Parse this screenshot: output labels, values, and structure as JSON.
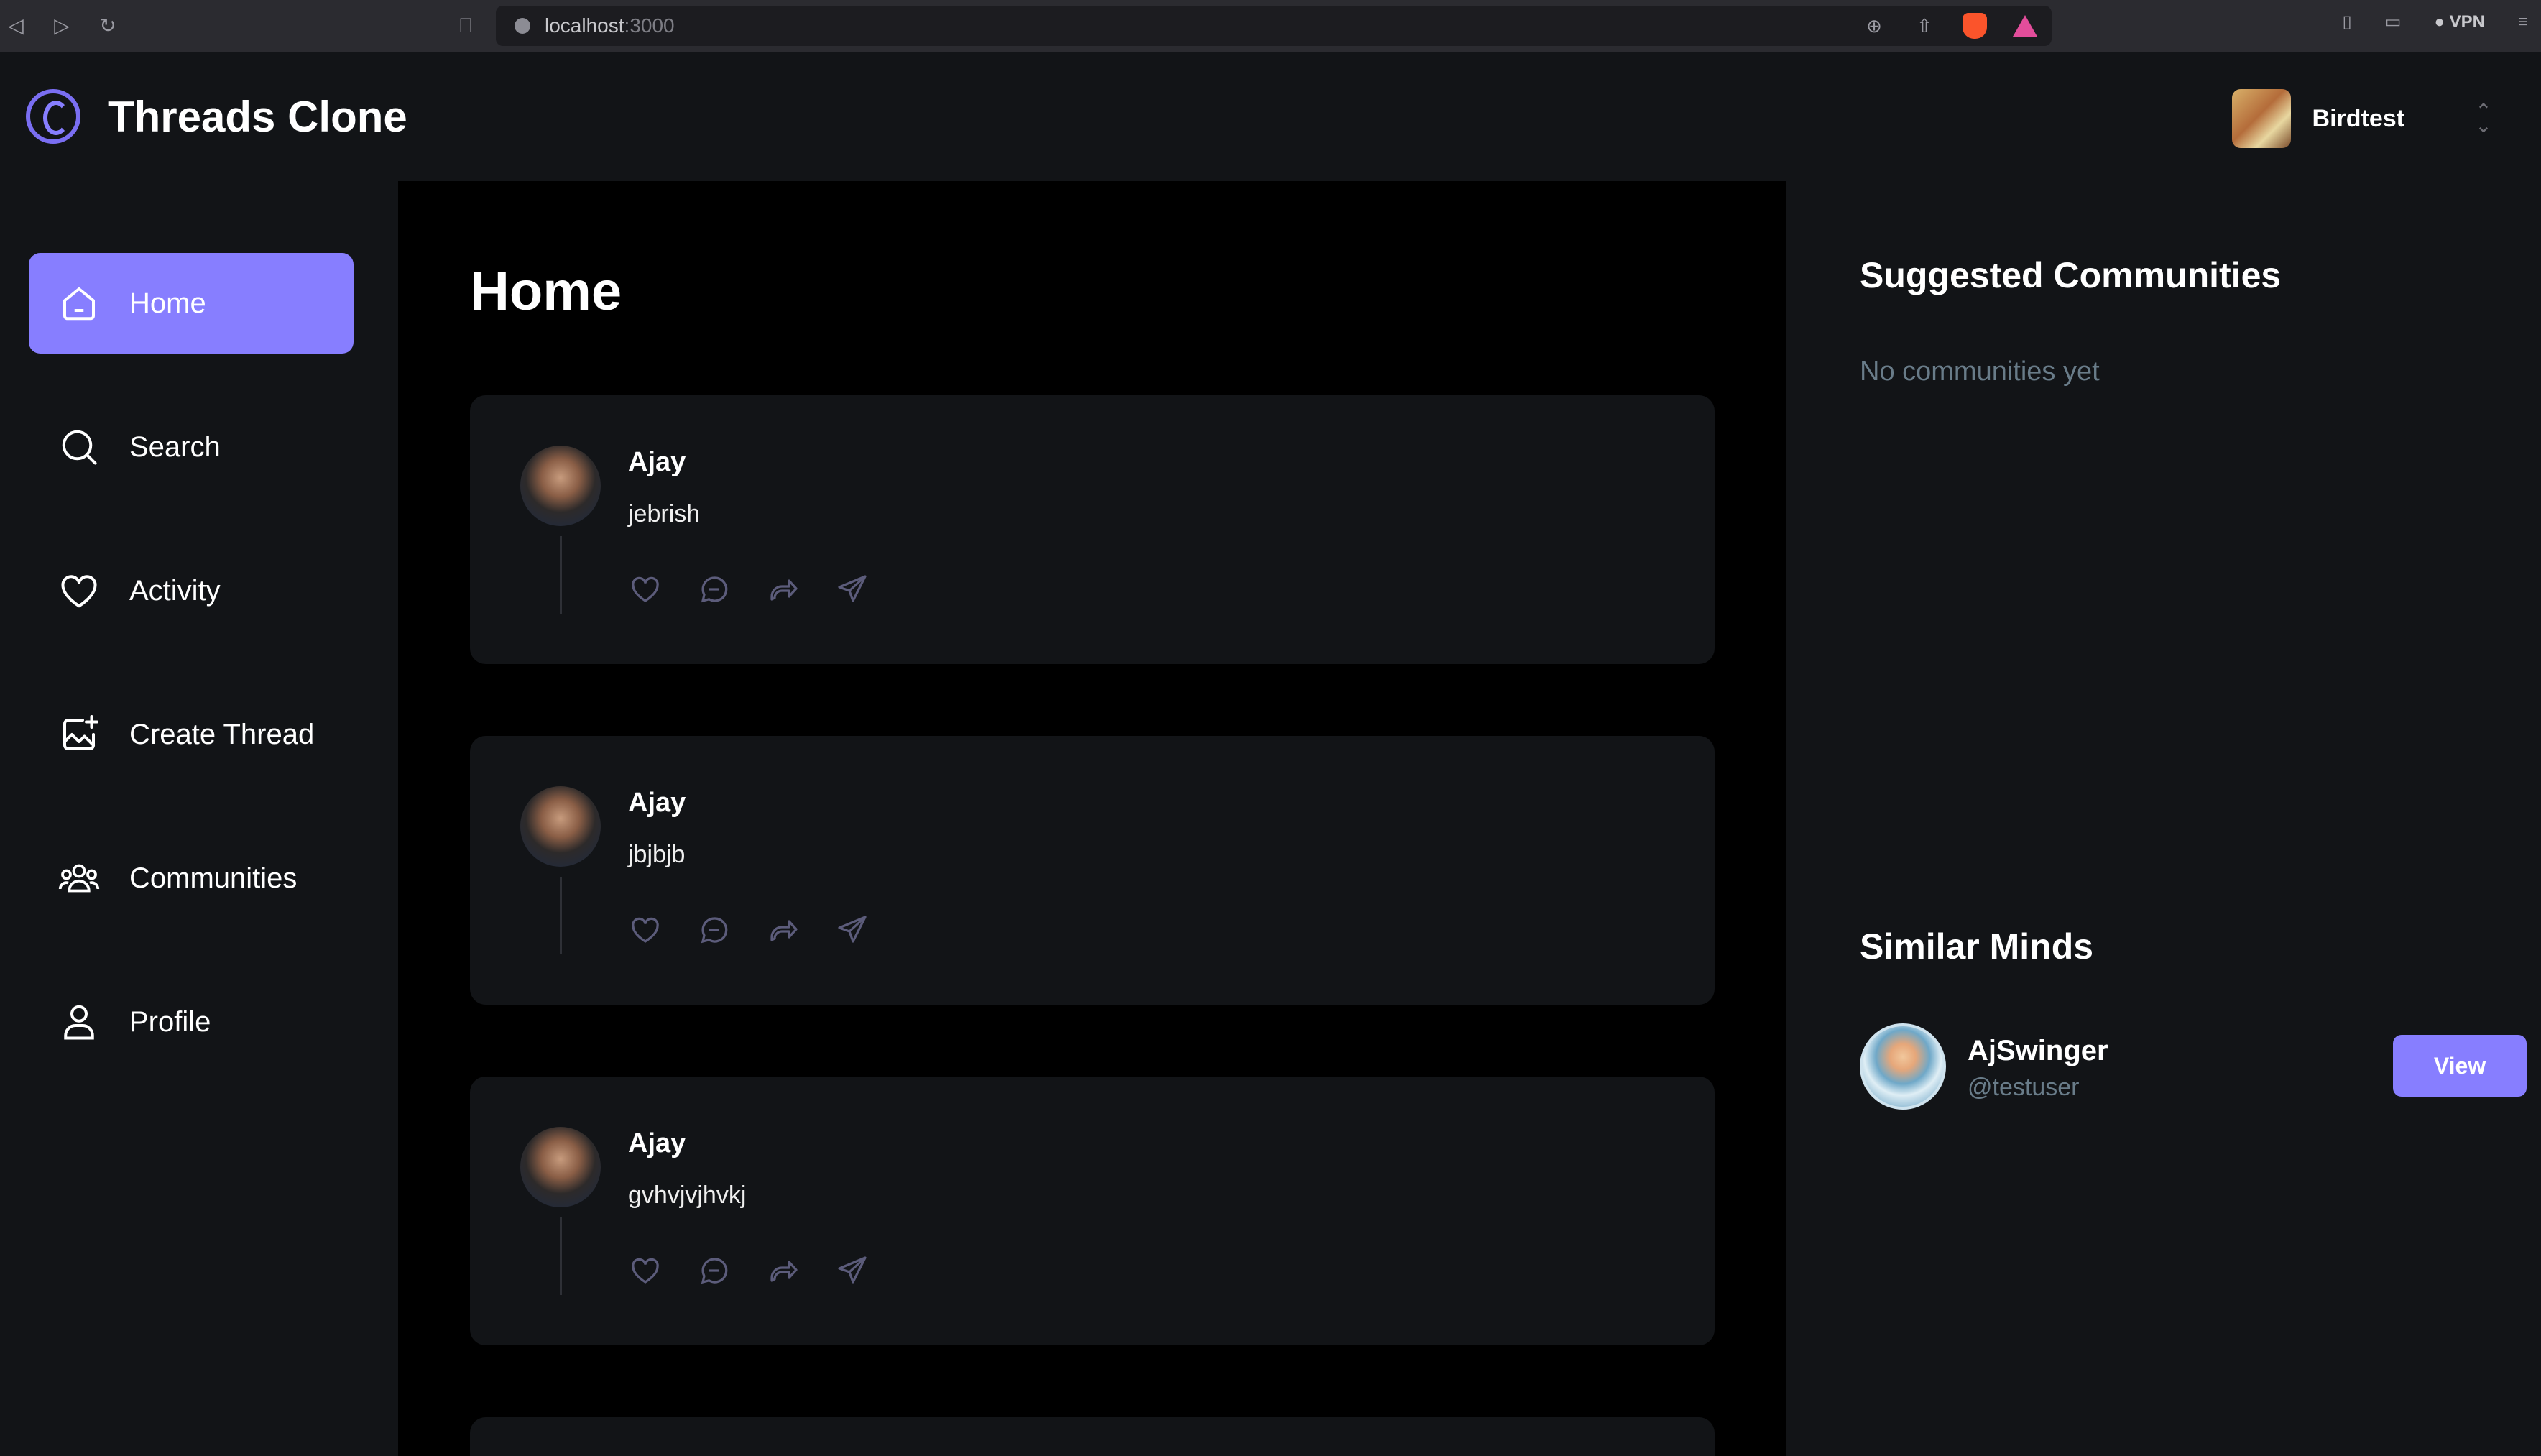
{
  "browser": {
    "url_host": "localhost",
    "url_port": ":3000",
    "vpn_label": "VPN"
  },
  "header": {
    "app_title": "Threads Clone",
    "org_name": "Birdtest"
  },
  "sidebar": {
    "items": [
      {
        "label": "Home",
        "icon": "home-icon",
        "active": true
      },
      {
        "label": "Search",
        "icon": "search-icon",
        "active": false
      },
      {
        "label": "Activity",
        "icon": "heart-icon",
        "active": false
      },
      {
        "label": "Create Thread",
        "icon": "create-thread-icon",
        "active": false
      },
      {
        "label": "Communities",
        "icon": "communities-icon",
        "active": false
      },
      {
        "label": "Profile",
        "icon": "profile-icon",
        "active": false
      }
    ]
  },
  "main": {
    "title": "Home",
    "threads": [
      {
        "author": "Ajay",
        "content": "jebrish"
      },
      {
        "author": "Ajay",
        "content": "jbjbjb"
      },
      {
        "author": "Ajay",
        "content": "gvhvjvjhvkj"
      }
    ]
  },
  "rightbar": {
    "communities_title": "Suggested Communities",
    "communities_empty": "No communities yet",
    "minds_title": "Similar Minds",
    "minds": [
      {
        "name": "AjSwinger",
        "handle": "@testuser",
        "button_label": "View"
      }
    ]
  },
  "colors": {
    "accent": "#877eff",
    "sidebar_bg": "#121417",
    "feed_bg": "#000000",
    "card_bg": "#121417",
    "muted_text": "#697c89"
  }
}
